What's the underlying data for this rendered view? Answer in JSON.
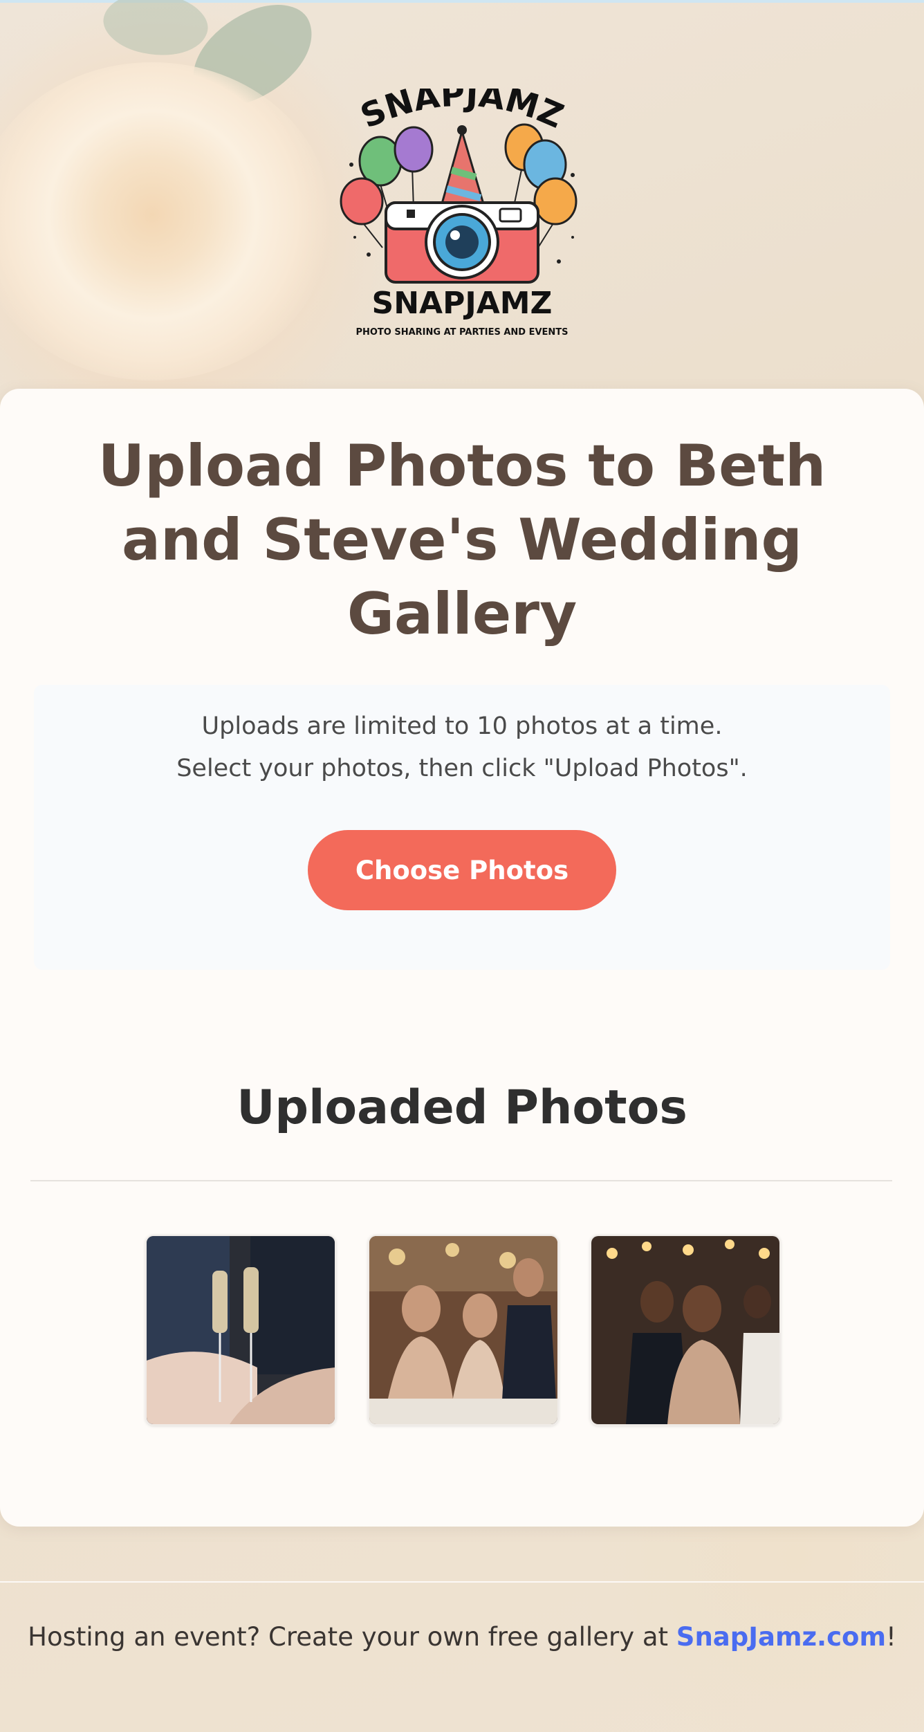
{
  "brand": {
    "logo_top_text": "SNAPJAMZ",
    "logo_bottom_text": "SNAPJAMZ",
    "logo_tagline": "PHOTO SHARING AT PARTIES AND EVENTS"
  },
  "main": {
    "title": "Upload Photos to Beth and Steve's Wedding Gallery",
    "info_line1": "Uploads are limited to 10 photos at a time.",
    "info_line2": "Select your photos, then click \"Upload Photos\".",
    "choose_button": "Choose Photos"
  },
  "uploaded": {
    "title": "Uploaded Photos",
    "photos": [
      {
        "subject": "champagne-toast-photo"
      },
      {
        "subject": "guests-at-table-photo"
      },
      {
        "subject": "couple-at-reception-photo"
      }
    ]
  },
  "footer": {
    "text_before": "Hosting an event? Create your own free gallery at ",
    "link": "SnapJamz.com",
    "text_after": "!"
  },
  "colors": {
    "accent_button": "#f36a5a",
    "title_text": "#5c4a40",
    "link": "#4a6cf0"
  }
}
